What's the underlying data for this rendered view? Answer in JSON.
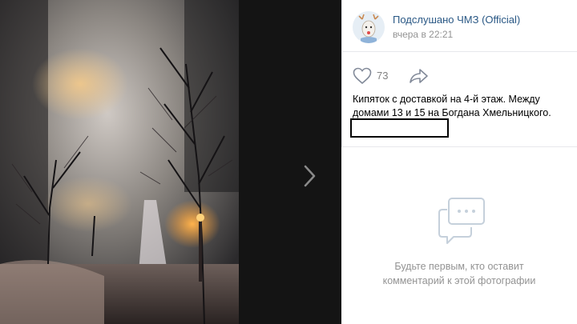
{
  "post": {
    "author_name": "Подслушано ЧМЗ (Official)",
    "time": "вчера в 22:21",
    "likes": "73",
    "caption": "Кипяток с доставкой на 4-й этаж. Между домами 13 и 15 на Богдана Хмельницкого."
  },
  "comments": {
    "empty_line1": "Будьте первым, кто оставит",
    "empty_line2": "комментарий к этой фотографии"
  },
  "icons": {
    "like": "heart-icon",
    "share": "share-arrow-icon",
    "next": "chevron-right-icon",
    "comments": "speech-bubble-icon"
  },
  "colors": {
    "link": "#2a5885",
    "muted": "#939393",
    "divider": "#e7e8ec",
    "viewer_bg": "#000000"
  }
}
